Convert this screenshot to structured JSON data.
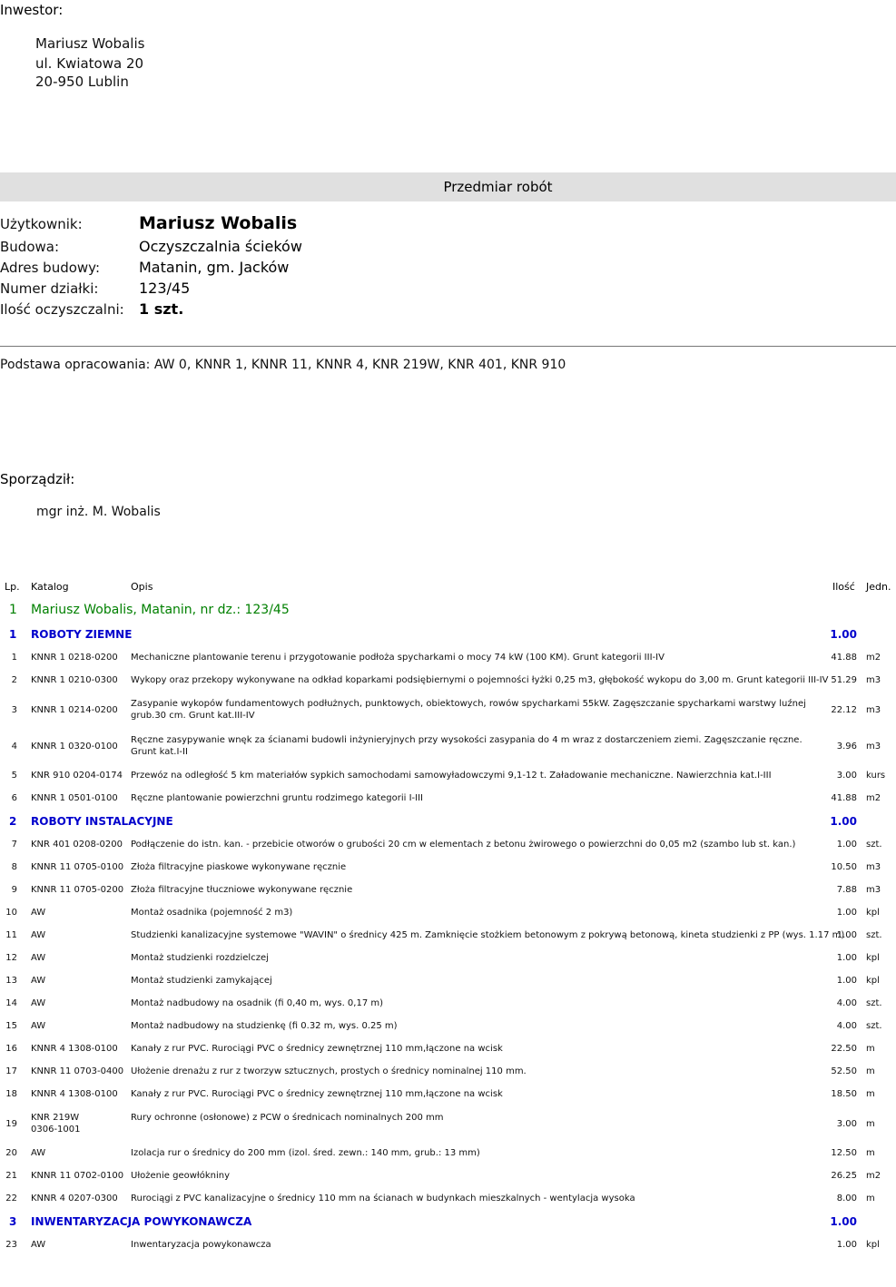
{
  "investor": {
    "label": "Inwestor:",
    "name": "Mariusz Wobalis",
    "street": "ul. Kwiatowa 20",
    "city": "20-950 Lublin"
  },
  "banner_title": "Przedmiar robót",
  "info": [
    {
      "label": "Użytkownik:",
      "value": "Mariusz Wobalis"
    },
    {
      "label": "Budowa:",
      "value": "Oczyszczalnia ścieków"
    },
    {
      "label": "Adres budowy:",
      "value": "Matanin, gm. Jacków"
    },
    {
      "label": "Numer działki:",
      "value": "123/45"
    },
    {
      "label": "Ilość oczyszczalni:",
      "value": "1 szt."
    }
  ],
  "basis": "Podstawa opracowania: AW 0, KNNR 1, KNNR 11, KNNR 4, KNR 219W, KNR 401, KNR 910",
  "prepared": {
    "label": "Sporządził:",
    "name": "mgr inż. M. Wobalis"
  },
  "table": {
    "headers": {
      "lp": "Lp.",
      "katalog": "Katalog",
      "opis": "Opis",
      "ilosc": "Ilość",
      "jedn": "Jedn."
    },
    "top_group": {
      "lp": "1",
      "text": "Mariusz Wobalis, Matanin, nr dz.: 123/45"
    },
    "sections": [
      {
        "lp": "1",
        "title": "ROBOTY ZIEMNE",
        "qty": "1.00"
      },
      {
        "lp": "2",
        "title": "ROBOTY INSTALACYJNE",
        "qty": "1.00"
      },
      {
        "lp": "3",
        "title": "INWENTARYZACJA POWYKONAWCZA",
        "qty": "1.00"
      }
    ],
    "rows": [
      {
        "lp": "1",
        "kat": "KNNR 1 0218-0200",
        "opis": "Mechaniczne plantowanie terenu i przygotowanie podłoża spycharkami o mocy 74 kW (100 KM). Grunt kategorii III-IV",
        "qty": "41.88",
        "unit": "m2"
      },
      {
        "lp": "2",
        "kat": "KNNR 1 0210-0300",
        "opis": "Wykopy oraz przekopy wykonywane na odkład koparkami podsiębiernymi o pojemności łyżki 0,25 m3, głębokość wykopu do 3,00 m. Grunt kategorii III-IV",
        "qty": "51.29",
        "unit": "m3"
      },
      {
        "lp": "3",
        "kat": "KNNR 1 0214-0200",
        "opis": "Zasypanie wykopów fundamentowych podłużnych, punktowych, obiektowych, rowów spycharkami 55kW. Zagęszczanie spycharkami warstwy luźnej grub.30 cm. Grunt kat.III-IV",
        "qty": "22.12",
        "unit": "m3"
      },
      {
        "lp": "4",
        "kat": "KNNR 1 0320-0100",
        "opis": "Ręczne zasypywanie wnęk za ścianami budowli inżynieryjnych przy wysokości zasypania do 4 m wraz z dostarczeniem ziemi. Zagęszczanie ręczne. Grunt kat.I-II",
        "qty": "3.96",
        "unit": "m3"
      },
      {
        "lp": "5",
        "kat": "KNR 910 0204-0174",
        "opis": "Przewóz na odległość 5 km materiałów sypkich samochodami samowyładowczymi 9,1-12 t. Załadowanie mechaniczne. Nawierzchnia kat.I-III",
        "qty": "3.00",
        "unit": "kurs"
      },
      {
        "lp": "6",
        "kat": "KNNR 1 0501-0100",
        "opis": "Ręczne plantowanie powierzchni gruntu rodzimego kategorii I-III",
        "qty": "41.88",
        "unit": "m2"
      },
      {
        "lp": "7",
        "kat": "KNR 401 0208-0200",
        "opis": "Podłączenie do istn. kan. - przebicie otworów o grubości 20 cm w elementach z betonu żwirowego o powierzchni do 0,05 m2 (szambo lub st. kan.)",
        "qty": "1.00",
        "unit": "szt."
      },
      {
        "lp": "8",
        "kat": "KNNR 11 0705-0100",
        "opis": "Złoża filtracyjne piaskowe wykonywane ręcznie",
        "qty": "10.50",
        "unit": "m3"
      },
      {
        "lp": "9",
        "kat": "KNNR 11 0705-0200",
        "opis": "Złoża filtracyjne tłuczniowe wykonywane ręcznie",
        "qty": "7.88",
        "unit": "m3"
      },
      {
        "lp": "10",
        "kat": "AW",
        "opis": "Montaż osadnika (pojemność 2 m3)",
        "qty": "1.00",
        "unit": "kpl"
      },
      {
        "lp": "11",
        "kat": "AW",
        "opis": "Studzienki kanalizacyjne systemowe \"WAVIN\" o średnicy 425 m. Zamknięcie stożkiem betonowym z pokrywą betonową, kineta studzienki z PP (wys. 1.17 m)",
        "qty": "1.00",
        "unit": "szt."
      },
      {
        "lp": "12",
        "kat": "AW",
        "opis": "Montaż studzienki rozdzielczej",
        "qty": "1.00",
        "unit": "kpl"
      },
      {
        "lp": "13",
        "kat": "AW",
        "opis": "Montaż studzienki zamykającej",
        "qty": "1.00",
        "unit": "kpl"
      },
      {
        "lp": "14",
        "kat": "AW",
        "opis": "Montaż nadbudowy na osadnik (fi 0,40 m, wys. 0,17 m)",
        "qty": "4.00",
        "unit": "szt."
      },
      {
        "lp": "15",
        "kat": "AW",
        "opis": "Montaż nadbudowy na studzienkę (fi 0.32 m, wys. 0.25 m)",
        "qty": "4.00",
        "unit": "szt."
      },
      {
        "lp": "16",
        "kat": "KNNR 4 1308-0100",
        "opis": "Kanały z rur PVC. Rurociągi PVC o średnicy zewnętrznej 110 mm,łączone na wcisk",
        "qty": "22.50",
        "unit": "m"
      },
      {
        "lp": "17",
        "kat": "KNNR 11 0703-0400",
        "opis": "Ułożenie drenażu z rur z tworzyw sztucznych, prostych o średnicy nominalnej 110 mm.",
        "qty": "52.50",
        "unit": "m"
      },
      {
        "lp": "18",
        "kat": "KNNR 4 1308-0100",
        "opis": "Kanały z rur PVC. Rurociągi PVC o średnicy zewnętrznej 110 mm,łączone na wcisk",
        "qty": "18.50",
        "unit": "m"
      },
      {
        "lp": "19",
        "kat": "KNR 219W 0306-1001",
        "opis": "Rury ochronne (osłonowe) z PCW o średnicach nominalnych 200 mm",
        "qty": "3.00",
        "unit": "m"
      },
      {
        "lp": "20",
        "kat": "AW",
        "opis": "Izolacja rur o średnicy do 200 mm (izol. śred. zewn.: 140 mm, grub.: 13 mm)",
        "qty": "12.50",
        "unit": "m"
      },
      {
        "lp": "21",
        "kat": "KNNR 11 0702-0100",
        "opis": "Ułożenie geowłókniny",
        "qty": "26.25",
        "unit": "m2"
      },
      {
        "lp": "22",
        "kat": "KNNR 4 0207-0300",
        "opis": "Rurociągi z PVC kanalizacyjne o średnicy 110 mm na ścianach w budynkach mieszkalnych - wentylacja wysoka",
        "qty": "8.00",
        "unit": "m"
      },
      {
        "lp": "23",
        "kat": "AW",
        "opis": "Inwentaryzacja powykonawcza",
        "qty": "1.00",
        "unit": "kpl"
      }
    ]
  }
}
